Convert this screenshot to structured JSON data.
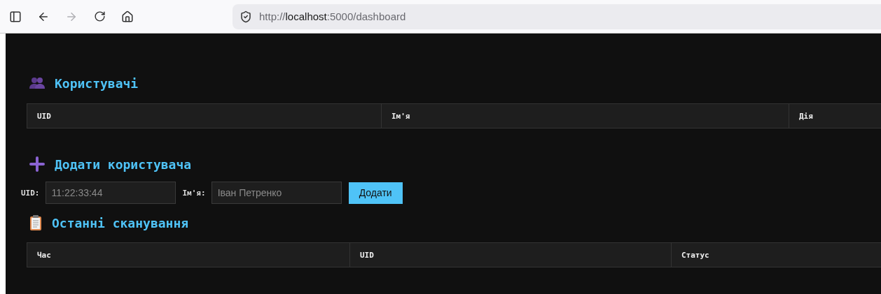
{
  "browser": {
    "url": {
      "scheme": "http://",
      "host": "localhost",
      "rest": ":5000/dashboard"
    }
  },
  "users": {
    "title": "Користувачі",
    "columns": [
      "UID",
      "Ім'я",
      "Дія"
    ]
  },
  "add_user": {
    "title": "Додати користувача",
    "uid_label": "UID:",
    "uid_placeholder": "11:22:33:44",
    "name_label": "Ім'я:",
    "name_placeholder": "Іван Петренко",
    "button": "Додати"
  },
  "scans": {
    "title": "Останні сканування",
    "columns": [
      "Час",
      "UID",
      "Статус"
    ]
  }
}
